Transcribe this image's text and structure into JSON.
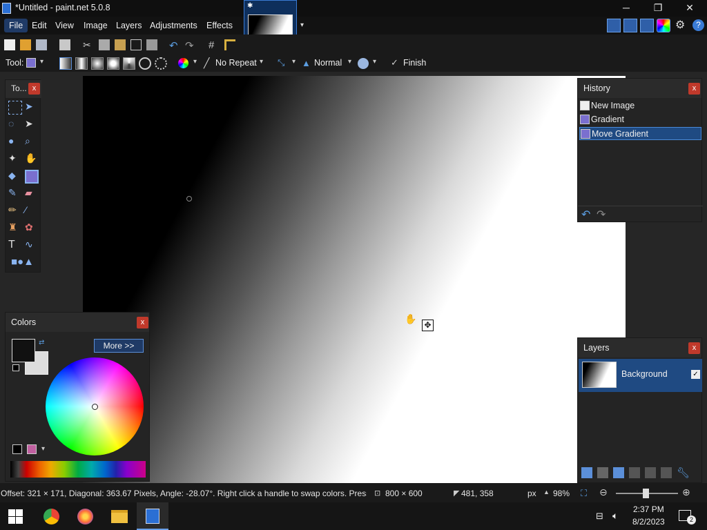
{
  "window": {
    "title": "*Untitled - paint.net 5.0.8",
    "controls": {
      "minimize": "─",
      "restore": "❐",
      "close": "✕"
    }
  },
  "menu": [
    "File",
    "Edit",
    "View",
    "Image",
    "Layers",
    "Adjustments",
    "Effects"
  ],
  "tool_options": {
    "tool_label": "Tool:",
    "repeat_mode": "No Repeat",
    "blend_mode": "Normal",
    "finish_label": "Finish"
  },
  "tools_panel": {
    "title": "To...",
    "close": "x"
  },
  "history": {
    "title": "History",
    "close": "x",
    "items": [
      "New Image",
      "Gradient",
      "Move Gradient"
    ],
    "selected_index": 2
  },
  "layers": {
    "title": "Layers",
    "close": "x",
    "items": [
      {
        "name": "Background",
        "visible": true
      }
    ]
  },
  "colors": {
    "title": "Colors",
    "close": "x",
    "more_label": "More >>",
    "primary_color": "#111111",
    "secondary_color": "#dddddd"
  },
  "status": {
    "message": "Offset: 321 × 171, Diagonal: 363.67 Pixels, Angle: -28.07°. Right click a handle to swap colors. Press Enter to finish.",
    "image_size": "800 × 600",
    "cursor_pos": "481, 358",
    "units": "px",
    "zoom": "98%"
  },
  "taskbar": {
    "time": "2:37 PM",
    "date": "8/2/2023",
    "notifications": "2"
  },
  "accent_color": "#1f4a82"
}
